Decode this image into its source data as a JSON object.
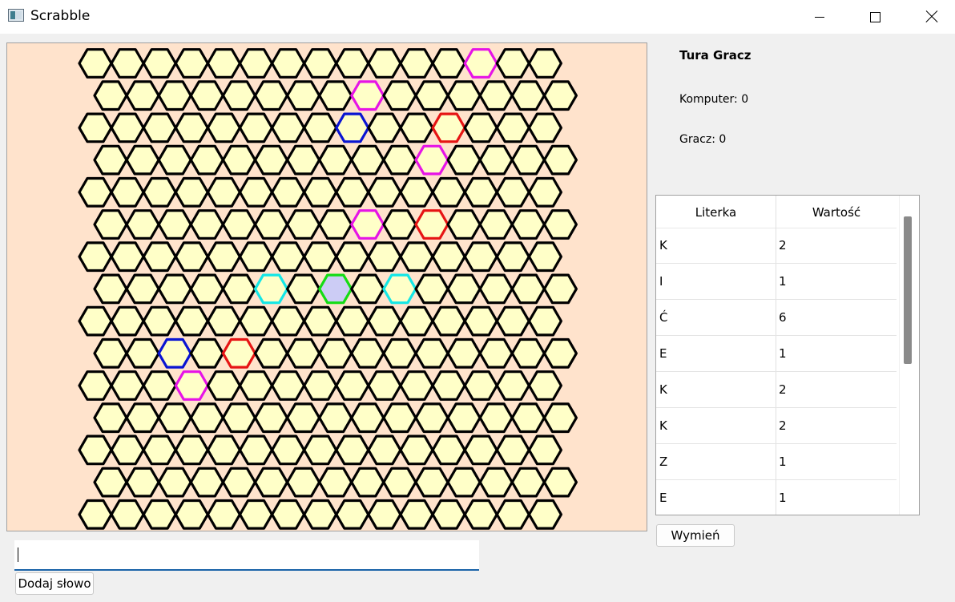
{
  "window": {
    "title": "Scrabble",
    "icon": "app-icon"
  },
  "board": {
    "background": "#ffe3cc",
    "cell_fill": "#ffffc8",
    "cell_stroke": "#000000",
    "rows": 15,
    "cols": 15,
    "highlights": [
      {
        "row": 0,
        "col": 12,
        "color": "#e614e6"
      },
      {
        "row": 1,
        "col": 8,
        "color": "#e614e6"
      },
      {
        "row": 2,
        "col": 8,
        "color": "#0a14d2"
      },
      {
        "row": 2,
        "col": 11,
        "color": "#e61414"
      },
      {
        "row": 3,
        "col": 10,
        "color": "#e614e6"
      },
      {
        "row": 5,
        "col": 8,
        "color": "#e614e6"
      },
      {
        "row": 5,
        "col": 10,
        "color": "#e61414"
      },
      {
        "row": 7,
        "col": 5,
        "color": "#14e6e6"
      },
      {
        "row": 7,
        "col": 7,
        "color": "#14dc14",
        "fill": "#ccccf5"
      },
      {
        "row": 7,
        "col": 9,
        "color": "#14e6e6"
      },
      {
        "row": 9,
        "col": 2,
        "color": "#0a14d2"
      },
      {
        "row": 9,
        "col": 4,
        "color": "#e61414"
      },
      {
        "row": 10,
        "col": 3,
        "color": "#e614e6"
      }
    ]
  },
  "status": {
    "turn": "Tura Gracz",
    "computer_score": "Komputer: 0",
    "player_score": "Gracz: 0"
  },
  "letters_table": {
    "headers": [
      "Literka",
      "Wartość"
    ],
    "rows": [
      [
        "K",
        "2"
      ],
      [
        "I",
        "1"
      ],
      [
        "Ć",
        "6"
      ],
      [
        "E",
        "1"
      ],
      [
        "K",
        "2"
      ],
      [
        "K",
        "2"
      ],
      [
        "Z",
        "1"
      ],
      [
        "E",
        "1"
      ]
    ]
  },
  "buttons": {
    "swap": "Wymień",
    "add_word": "Dodaj słowo"
  },
  "word_input": {
    "value": ""
  }
}
